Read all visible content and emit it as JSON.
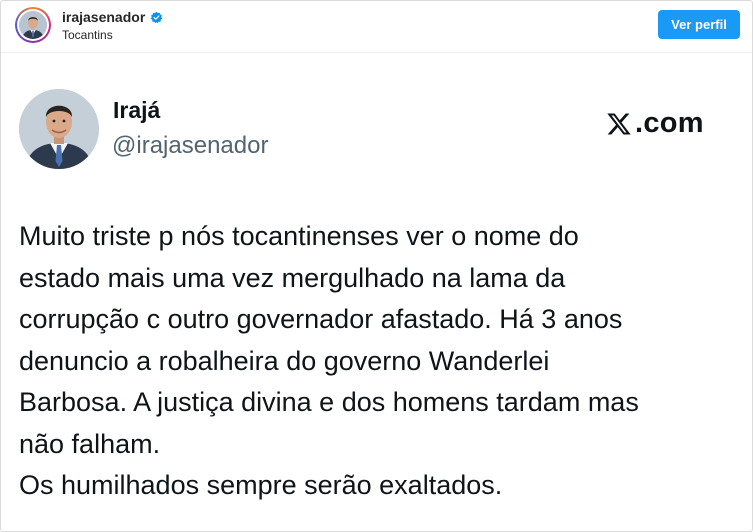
{
  "header": {
    "username": "irajasenador",
    "location": "Tocantins",
    "view_profile_label": "Ver perfil",
    "verified_icon": "verified-badge-icon",
    "accent_color": "#1a9af6"
  },
  "tweet": {
    "display_name": "Irajá",
    "handle": "@irajasenador",
    "source_label": ".com",
    "source_icon": "x-logo-icon",
    "lines": [
      "Muito triste p nós tocantinenses ver o nome do",
      "estado mais uma vez mergulhado na lama da",
      "corrupção c outro governador afastado. Há 3 anos",
      "denuncio a robalheira do governo Wanderlei",
      "Barbosa. A justiça divina e dos homens tardam mas",
      "não falham.",
      "Os humilhados sempre serão exaltados."
    ]
  }
}
